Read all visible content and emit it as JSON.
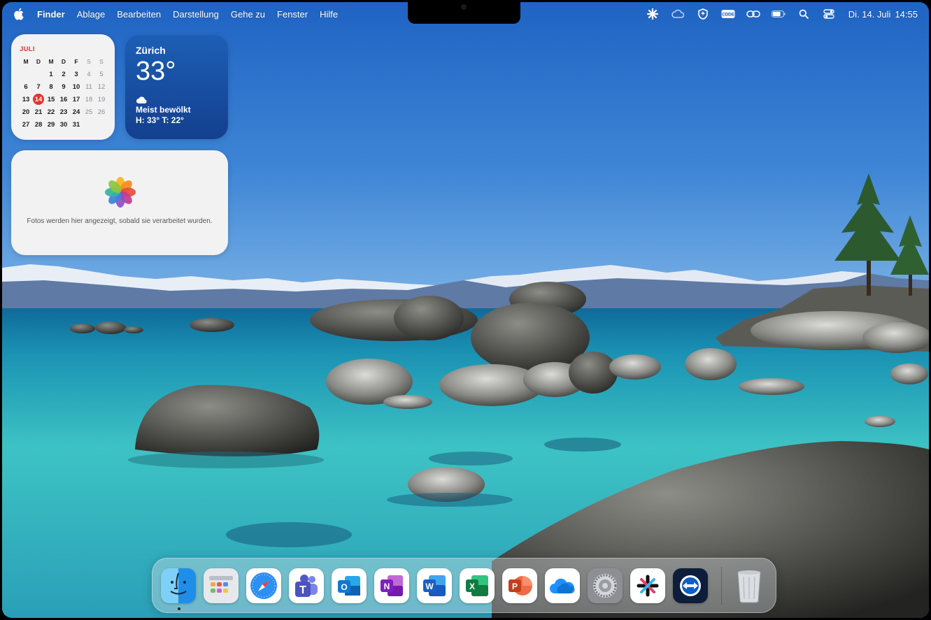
{
  "menubar": {
    "app_name": "Finder",
    "items": [
      "Ablage",
      "Bearbeiten",
      "Darstellung",
      "Gehe zu",
      "Fenster",
      "Hilfe"
    ],
    "status_icons": [
      "perplexity-icon",
      "creative-cloud-icon",
      "vpn-shield-icon",
      "cdde-icon",
      "link-icon",
      "battery-icon",
      "search-icon",
      "control-center-icon"
    ],
    "status_badge_text": "CDDE",
    "clock_date": "Di. 14. Juli",
    "clock_time": "14:55"
  },
  "calendar_widget": {
    "month": "JULI",
    "weekday_headers": [
      "M",
      "D",
      "M",
      "D",
      "F",
      "S",
      "S"
    ],
    "weeks": [
      [
        "",
        "",
        "1",
        "2",
        "3",
        "4",
        "5"
      ],
      [
        "6",
        "7",
        "8",
        "9",
        "10",
        "11",
        "12"
      ],
      [
        "13",
        "14",
        "15",
        "16",
        "17",
        "18",
        "19"
      ],
      [
        "20",
        "21",
        "22",
        "23",
        "24",
        "25",
        "26"
      ],
      [
        "27",
        "28",
        "29",
        "30",
        "31",
        "",
        ""
      ]
    ],
    "today": "14",
    "today_color": "#e5342b"
  },
  "weather_widget": {
    "city": "Zürich",
    "temperature": "33°",
    "condition_icon": "cloud-icon",
    "condition": "Meist bewölkt",
    "high_low": "H: 33° T: 22°"
  },
  "photos_widget": {
    "icon": "photos-icon",
    "message": "Fotos werden hier angezeigt, sobald sie verarbeitet wurden."
  },
  "dock": {
    "apps": [
      {
        "name": "finder-icon",
        "running": true
      },
      {
        "name": "launchpad-icon",
        "running": false
      },
      {
        "name": "safari-icon",
        "running": false
      },
      {
        "name": "teams-icon",
        "running": false
      },
      {
        "name": "outlook-icon",
        "running": false
      },
      {
        "name": "onenote-icon",
        "running": false
      },
      {
        "name": "word-icon",
        "running": false
      },
      {
        "name": "excel-icon",
        "running": false
      },
      {
        "name": "powerpoint-icon",
        "running": false
      },
      {
        "name": "onedrive-icon",
        "running": false
      },
      {
        "name": "system-settings-icon",
        "running": false
      },
      {
        "name": "perplexity-icon",
        "running": false
      },
      {
        "name": "teamviewer-icon",
        "running": false
      }
    ],
    "trash": "trash-icon"
  }
}
